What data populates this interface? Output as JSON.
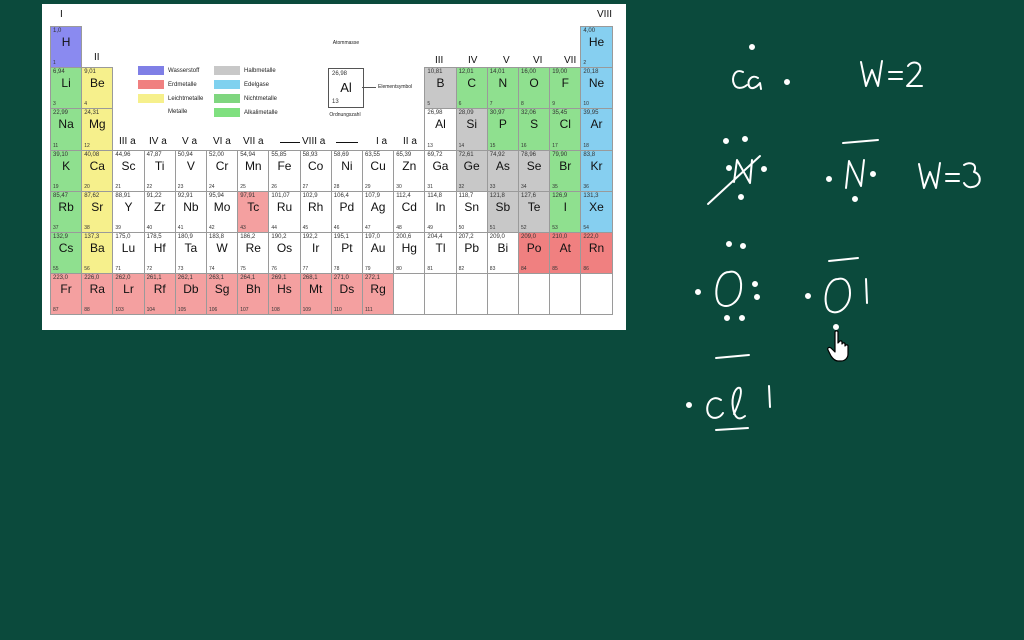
{
  "periodic_table": {
    "group_labels": {
      "g1": "I",
      "g2": "II",
      "g13": "III",
      "g14": "IV",
      "g15": "V",
      "g16": "VI",
      "g17": "VII",
      "g18": "VIII",
      "g3": "III a",
      "g4": "IV a",
      "g5": "V a",
      "g6": "VI a",
      "g7": "VII a",
      "g8": "VIII a",
      "g11": "I a",
      "g12": "II a"
    },
    "legend": {
      "title": "Metalle",
      "items": [
        {
          "label": "Wasserstoff",
          "color": "#7f7fe6"
        },
        {
          "label": "Erdmetalle",
          "color": "#f08080"
        },
        {
          "label": "Leichtmetalle",
          "color": "#f6f08c"
        },
        {
          "label": "Halbmetalle",
          "color": "#c8c8c8"
        },
        {
          "label": "Edelgase",
          "color": "#7fd1ef"
        },
        {
          "label": "Nichtmetalle",
          "color": "#7fd67f"
        },
        {
          "label": "Alkalimetalle",
          "color": "#7fe07f"
        }
      ]
    },
    "key": {
      "mass_caption": "Atommasse",
      "mass": "26,98",
      "symbol": "Al",
      "number": "13",
      "symbol_caption": "Elementsymbol",
      "number_caption": "Ordnungszahl"
    },
    "elements": [
      {
        "s": "H",
        "m": "1,0",
        "z": "1",
        "c": "#8a8af0",
        "r": 0,
        "g": 0
      },
      {
        "s": "He",
        "m": "4,00",
        "z": "2",
        "c": "#86cff0",
        "r": 0,
        "g": 17
      },
      {
        "s": "Li",
        "m": "6,94",
        "z": "3",
        "c": "#8fe08f",
        "r": 1,
        "g": 0
      },
      {
        "s": "Be",
        "m": "9,01",
        "z": "4",
        "c": "#f6f08c",
        "r": 1,
        "g": 1
      },
      {
        "s": "B",
        "m": "10,81",
        "z": "5",
        "c": "#c8c8c8",
        "r": 1,
        "g": 12
      },
      {
        "s": "C",
        "m": "12,01",
        "z": "6",
        "c": "#8fe08f",
        "r": 1,
        "g": 13
      },
      {
        "s": "N",
        "m": "14,01",
        "z": "7",
        "c": "#8fe08f",
        "r": 1,
        "g": 14
      },
      {
        "s": "O",
        "m": "16,00",
        "z": "8",
        "c": "#8fe08f",
        "r": 1,
        "g": 15
      },
      {
        "s": "F",
        "m": "19,00",
        "z": "9",
        "c": "#8fe08f",
        "r": 1,
        "g": 16
      },
      {
        "s": "Ne",
        "m": "20,18",
        "z": "10",
        "c": "#86cff0",
        "r": 1,
        "g": 17
      },
      {
        "s": "Na",
        "m": "22,99",
        "z": "11",
        "c": "#8fe08f",
        "r": 2,
        "g": 0
      },
      {
        "s": "Mg",
        "m": "24,31",
        "z": "12",
        "c": "#f6f08c",
        "r": 2,
        "g": 1
      },
      {
        "s": "Al",
        "m": "26,98",
        "z": "13",
        "c": "#ffffff",
        "r": 2,
        "g": 12
      },
      {
        "s": "Si",
        "m": "28,09",
        "z": "14",
        "c": "#c8c8c8",
        "r": 2,
        "g": 13
      },
      {
        "s": "P",
        "m": "30,97",
        "z": "15",
        "c": "#8fe08f",
        "r": 2,
        "g": 14
      },
      {
        "s": "S",
        "m": "32,06",
        "z": "16",
        "c": "#8fe08f",
        "r": 2,
        "g": 15
      },
      {
        "s": "Cl",
        "m": "35,45",
        "z": "17",
        "c": "#8fe08f",
        "r": 2,
        "g": 16
      },
      {
        "s": "Ar",
        "m": "39,95",
        "z": "18",
        "c": "#86cff0",
        "r": 2,
        "g": 17
      },
      {
        "s": "K",
        "m": "39,10",
        "z": "19",
        "c": "#8fe08f",
        "r": 3,
        "g": 0
      },
      {
        "s": "Ca",
        "m": "40,08",
        "z": "20",
        "c": "#f6f08c",
        "r": 3,
        "g": 1
      },
      {
        "s": "Sc",
        "m": "44,96",
        "z": "21",
        "c": "#ffffff",
        "r": 3,
        "g": 2
      },
      {
        "s": "Ti",
        "m": "47,87",
        "z": "22",
        "c": "#ffffff",
        "r": 3,
        "g": 3
      },
      {
        "s": "V",
        "m": "50,94",
        "z": "23",
        "c": "#ffffff",
        "r": 3,
        "g": 4
      },
      {
        "s": "Cr",
        "m": "52,00",
        "z": "24",
        "c": "#ffffff",
        "r": 3,
        "g": 5
      },
      {
        "s": "Mn",
        "m": "54,94",
        "z": "25",
        "c": "#ffffff",
        "r": 3,
        "g": 6
      },
      {
        "s": "Fe",
        "m": "55,85",
        "z": "26",
        "c": "#ffffff",
        "r": 3,
        "g": 7
      },
      {
        "s": "Co",
        "m": "58,93",
        "z": "27",
        "c": "#ffffff",
        "r": 3,
        "g": 8
      },
      {
        "s": "Ni",
        "m": "58,69",
        "z": "28",
        "c": "#ffffff",
        "r": 3,
        "g": 9
      },
      {
        "s": "Cu",
        "m": "63,55",
        "z": "29",
        "c": "#ffffff",
        "r": 3,
        "g": 10
      },
      {
        "s": "Zn",
        "m": "65,39",
        "z": "30",
        "c": "#ffffff",
        "r": 3,
        "g": 11
      },
      {
        "s": "Ga",
        "m": "69,72",
        "z": "31",
        "c": "#ffffff",
        "r": 3,
        "g": 12
      },
      {
        "s": "Ge",
        "m": "72,61",
        "z": "32",
        "c": "#c8c8c8",
        "r": 3,
        "g": 13
      },
      {
        "s": "As",
        "m": "74,92",
        "z": "33",
        "c": "#c8c8c8",
        "r": 3,
        "g": 14
      },
      {
        "s": "Se",
        "m": "78,96",
        "z": "34",
        "c": "#c8c8c8",
        "r": 3,
        "g": 15
      },
      {
        "s": "Br",
        "m": "79,90",
        "z": "35",
        "c": "#8fe08f",
        "r": 3,
        "g": 16
      },
      {
        "s": "Kr",
        "m": "83,8",
        "z": "36",
        "c": "#86cff0",
        "r": 3,
        "g": 17
      },
      {
        "s": "Rb",
        "m": "85,47",
        "z": "37",
        "c": "#8fe08f",
        "r": 4,
        "g": 0
      },
      {
        "s": "Sr",
        "m": "87,62",
        "z": "38",
        "c": "#f6f08c",
        "r": 4,
        "g": 1
      },
      {
        "s": "Y",
        "m": "88,91",
        "z": "39",
        "c": "#ffffff",
        "r": 4,
        "g": 2
      },
      {
        "s": "Zr",
        "m": "91,22",
        "z": "40",
        "c": "#ffffff",
        "r": 4,
        "g": 3
      },
      {
        "s": "Nb",
        "m": "92,91",
        "z": "41",
        "c": "#ffffff",
        "r": 4,
        "g": 4
      },
      {
        "s": "Mo",
        "m": "95,94",
        "z": "42",
        "c": "#ffffff",
        "r": 4,
        "g": 5
      },
      {
        "s": "Tc",
        "m": "97,91",
        "z": "43",
        "c": "#f4a0a0",
        "r": 4,
        "g": 6
      },
      {
        "s": "Ru",
        "m": "101,07",
        "z": "44",
        "c": "#ffffff",
        "r": 4,
        "g": 7
      },
      {
        "s": "Rh",
        "m": "102,9",
        "z": "45",
        "c": "#ffffff",
        "r": 4,
        "g": 8
      },
      {
        "s": "Pd",
        "m": "106,4",
        "z": "46",
        "c": "#ffffff",
        "r": 4,
        "g": 9
      },
      {
        "s": "Ag",
        "m": "107,9",
        "z": "47",
        "c": "#ffffff",
        "r": 4,
        "g": 10
      },
      {
        "s": "Cd",
        "m": "112,4",
        "z": "48",
        "c": "#ffffff",
        "r": 4,
        "g": 11
      },
      {
        "s": "In",
        "m": "114,8",
        "z": "49",
        "c": "#ffffff",
        "r": 4,
        "g": 12
      },
      {
        "s": "Sn",
        "m": "118,7",
        "z": "50",
        "c": "#ffffff",
        "r": 4,
        "g": 13
      },
      {
        "s": "Sb",
        "m": "121,8",
        "z": "51",
        "c": "#c8c8c8",
        "r": 4,
        "g": 14
      },
      {
        "s": "Te",
        "m": "127,6",
        "z": "52",
        "c": "#c8c8c8",
        "r": 4,
        "g": 15
      },
      {
        "s": "I",
        "m": "126,9",
        "z": "53",
        "c": "#8fe08f",
        "r": 4,
        "g": 16
      },
      {
        "s": "Xe",
        "m": "131,3",
        "z": "54",
        "c": "#86cff0",
        "r": 4,
        "g": 17
      },
      {
        "s": "Cs",
        "m": "132,9",
        "z": "55",
        "c": "#8fe08f",
        "r": 5,
        "g": 0
      },
      {
        "s": "Ba",
        "m": "137,3",
        "z": "56",
        "c": "#f6f08c",
        "r": 5,
        "g": 1
      },
      {
        "s": "Lu",
        "m": "175,0",
        "z": "71",
        "c": "#ffffff",
        "r": 5,
        "g": 2
      },
      {
        "s": "Hf",
        "m": "178,5",
        "z": "72",
        "c": "#ffffff",
        "r": 5,
        "g": 3
      },
      {
        "s": "Ta",
        "m": "180,9",
        "z": "73",
        "c": "#ffffff",
        "r": 5,
        "g": 4
      },
      {
        "s": "W",
        "m": "183,8",
        "z": "74",
        "c": "#ffffff",
        "r": 5,
        "g": 5
      },
      {
        "s": "Re",
        "m": "186,2",
        "z": "75",
        "c": "#ffffff",
        "r": 5,
        "g": 6
      },
      {
        "s": "Os",
        "m": "190,2",
        "z": "76",
        "c": "#ffffff",
        "r": 5,
        "g": 7
      },
      {
        "s": "Ir",
        "m": "192,2",
        "z": "77",
        "c": "#ffffff",
        "r": 5,
        "g": 8
      },
      {
        "s": "Pt",
        "m": "195,1",
        "z": "78",
        "c": "#ffffff",
        "r": 5,
        "g": 9
      },
      {
        "s": "Au",
        "m": "197,0",
        "z": "79",
        "c": "#ffffff",
        "r": 5,
        "g": 10
      },
      {
        "s": "Hg",
        "m": "200,6",
        "z": "80",
        "c": "#ffffff",
        "r": 5,
        "g": 11
      },
      {
        "s": "Tl",
        "m": "204,4",
        "z": "81",
        "c": "#ffffff",
        "r": 5,
        "g": 12
      },
      {
        "s": "Pb",
        "m": "207,2",
        "z": "82",
        "c": "#ffffff",
        "r": 5,
        "g": 13
      },
      {
        "s": "Bi",
        "m": "209,0",
        "z": "83",
        "c": "#ffffff",
        "r": 5,
        "g": 14
      },
      {
        "s": "Po",
        "m": "209,0",
        "z": "84",
        "c": "#f08080",
        "r": 5,
        "g": 15
      },
      {
        "s": "At",
        "m": "210,0",
        "z": "85",
        "c": "#f08080",
        "r": 5,
        "g": 16
      },
      {
        "s": "Rn",
        "m": "222,0",
        "z": "86",
        "c": "#f08080",
        "r": 5,
        "g": 17
      },
      {
        "s": "Fr",
        "m": "223,0",
        "z": "87",
        "c": "#f4a0a0",
        "r": 6,
        "g": 0
      },
      {
        "s": "Ra",
        "m": "226,0",
        "z": "88",
        "c": "#f4a0a0",
        "r": 6,
        "g": 1
      },
      {
        "s": "Lr",
        "m": "262,0",
        "z": "103",
        "c": "#f4a0a0",
        "r": 6,
        "g": 2
      },
      {
        "s": "Rf",
        "m": "261,1",
        "z": "104",
        "c": "#f4a0a0",
        "r": 6,
        "g": 3
      },
      {
        "s": "Db",
        "m": "262,1",
        "z": "105",
        "c": "#f4a0a0",
        "r": 6,
        "g": 4
      },
      {
        "s": "Sg",
        "m": "263,1",
        "z": "106",
        "c": "#f4a0a0",
        "r": 6,
        "g": 5
      },
      {
        "s": "Bh",
        "m": "264,1",
        "z": "107",
        "c": "#f4a0a0",
        "r": 6,
        "g": 6
      },
      {
        "s": "Hs",
        "m": "269,1",
        "z": "108",
        "c": "#f4a0a0",
        "r": 6,
        "g": 7
      },
      {
        "s": "Mt",
        "m": "268,1",
        "z": "109",
        "c": "#f4a0a0",
        "r": 6,
        "g": 8
      },
      {
        "s": "Ds",
        "m": "271,0",
        "z": "110",
        "c": "#f4a0a0",
        "r": 6,
        "g": 9
      },
      {
        "s": "Rg",
        "m": "272,1",
        "z": "111",
        "c": "#f4a0a0",
        "r": 6,
        "g": 10
      },
      {
        "s": "",
        "m": "",
        "z": "",
        "c": "#ffffff",
        "r": 6,
        "g": 11
      },
      {
        "s": "",
        "m": "",
        "z": "",
        "c": "#ffffff",
        "r": 6,
        "g": 12
      },
      {
        "s": "",
        "m": "",
        "z": "",
        "c": "#ffffff",
        "r": 6,
        "g": 13
      },
      {
        "s": "",
        "m": "",
        "z": "",
        "c": "#ffffff",
        "r": 6,
        "g": 14
      },
      {
        "s": "",
        "m": "",
        "z": "",
        "c": "#ffffff",
        "r": 6,
        "g": 15
      },
      {
        "s": "",
        "m": "",
        "z": "",
        "c": "#ffffff",
        "r": 6,
        "g": 16
      },
      {
        "s": "",
        "m": "",
        "z": "",
        "c": "#ffffff",
        "r": 6,
        "g": 17
      }
    ]
  },
  "handwriting": {
    "ca_label": "Ca",
    "ca_w": "W=2",
    "n_label": "N",
    "n_w": "W=3",
    "o_label": "O",
    "cl_label": "Cl"
  },
  "colors": {
    "board": "#0b4a3c",
    "chalk": "#ffffff"
  }
}
